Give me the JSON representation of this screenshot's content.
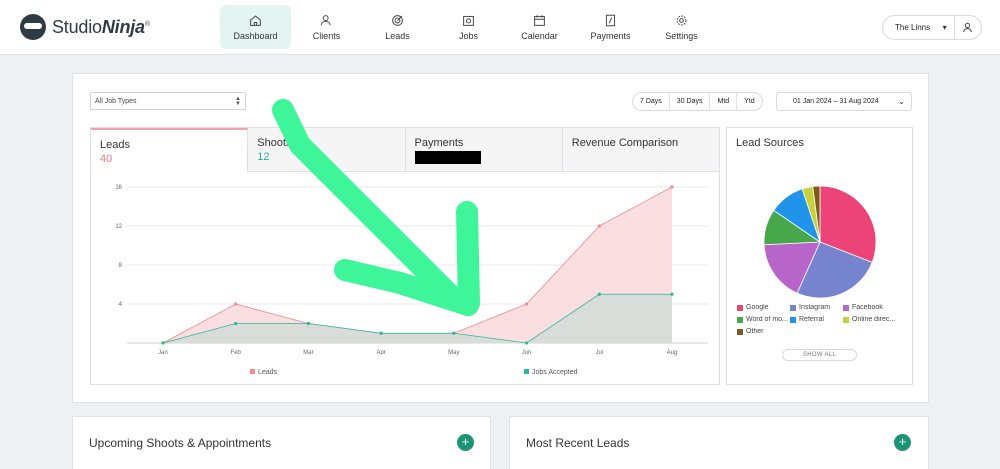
{
  "brand": {
    "name_regular": "Studio",
    "name_bold": "Ninja",
    "trademark": "®"
  },
  "nav": [
    {
      "label": "Dashboard",
      "icon": "home-icon",
      "active": true
    },
    {
      "label": "Clients",
      "icon": "clients-icon"
    },
    {
      "label": "Leads",
      "icon": "target-icon"
    },
    {
      "label": "Jobs",
      "icon": "camera-icon"
    },
    {
      "label": "Calendar",
      "icon": "calendar-icon"
    },
    {
      "label": "Payments",
      "icon": "invoice-icon"
    },
    {
      "label": "Settings",
      "icon": "gear-icon"
    }
  ],
  "account": {
    "name": "The Linns",
    "icon": "user-icon"
  },
  "filters": {
    "job_types": "All Job Types",
    "ranges": [
      "7 Days",
      "30 Days",
      "Mtd",
      "Ytd"
    ],
    "date_range": "01 Jan 2024 – 31 Aug 2024"
  },
  "tabs": [
    {
      "label": "Leads",
      "value": "40",
      "active": true
    },
    {
      "label": "Shoots",
      "value": "12"
    },
    {
      "label": "Payments",
      "value": "",
      "redacted": true
    },
    {
      "label": "Revenue Comparison",
      "value": ""
    }
  ],
  "chart_data": {
    "type": "area",
    "categories": [
      "Jan",
      "Feb",
      "Mar",
      "Apr",
      "May",
      "Jun",
      "Jul",
      "Aug"
    ],
    "yticks": [
      "4",
      "8",
      "12",
      "16"
    ],
    "ylim": [
      0,
      16
    ],
    "grid": true,
    "legend_position": "bottom",
    "series": [
      {
        "name": "Leads",
        "color": "#ee8a90",
        "fill": "#fadadd",
        "values": [
          0,
          4,
          2,
          1,
          1,
          4,
          12,
          16
        ]
      },
      {
        "name": "Jobs Accepted",
        "color": "#2cb8a0",
        "fill": "#d6dcd9",
        "values": [
          0,
          2,
          2,
          1,
          1,
          0,
          5,
          5
        ]
      }
    ]
  },
  "lead_sources": {
    "title": "Lead Sources",
    "show_all": "SHOW ALL",
    "items": [
      {
        "label": "Google",
        "color": "#ec4378",
        "value": 30
      },
      {
        "label": "Instagram",
        "color": "#7683cf",
        "value": 25
      },
      {
        "label": "Facebook",
        "color": "#b865c9",
        "value": 17
      },
      {
        "label": "Word of mo...",
        "color": "#46a84b",
        "value": 10
      },
      {
        "label": "Referral",
        "color": "#1f94e8",
        "value": 10
      },
      {
        "label": "Online direc...",
        "color": "#c6d23b",
        "value": 3
      },
      {
        "label": "Other",
        "color": "#7a5c1c",
        "value": 2
      }
    ]
  },
  "bottom": {
    "upcoming_title": "Upcoming Shoots & Appointments",
    "recent_title": "Most Recent Leads",
    "add_symbol": "+"
  },
  "colors": {
    "accent": "#1e9477",
    "active_nav": "#e4f5f1",
    "annotation": "#3ef59a"
  }
}
